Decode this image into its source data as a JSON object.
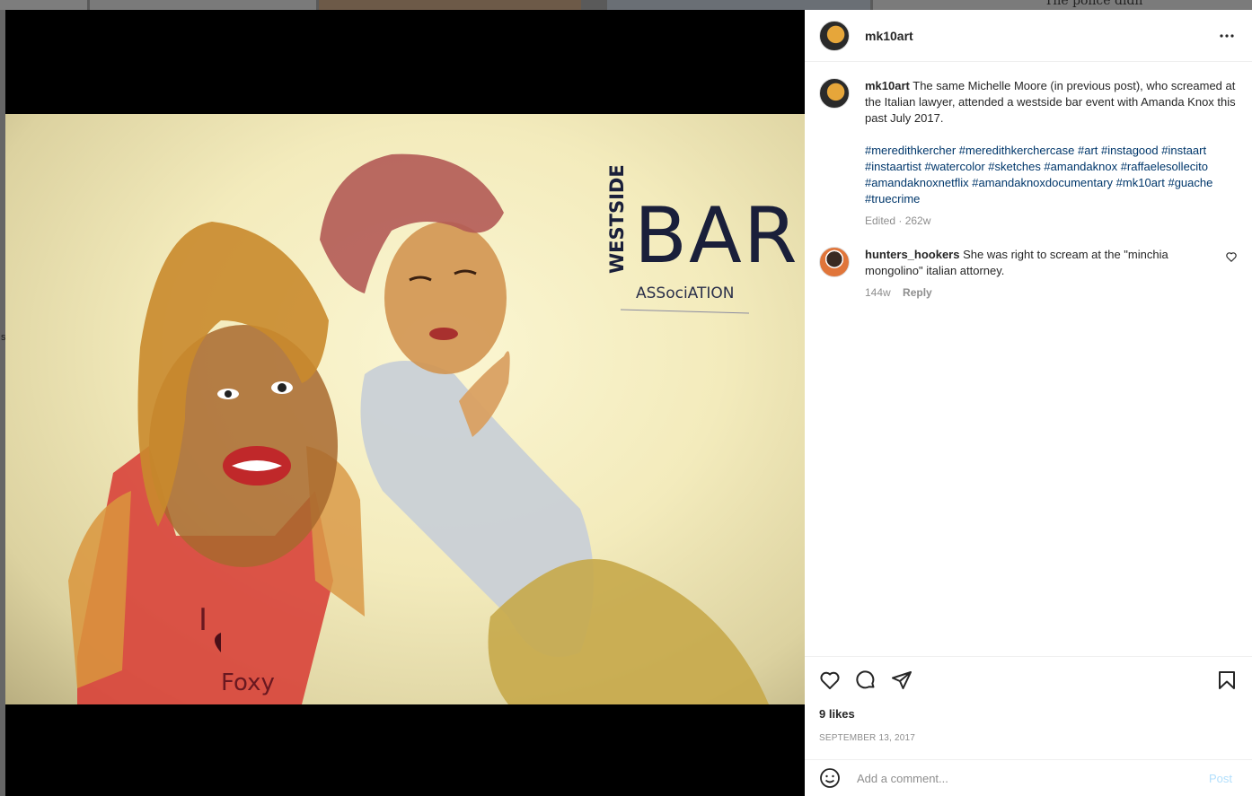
{
  "background": {
    "snippet_text": "The police didn",
    "side_letter": "s"
  },
  "post": {
    "username": "mk10art",
    "art_text": {
      "westside": "WESTSIDE",
      "bar": "BAR",
      "association": "ASSociATION",
      "i": "I",
      "foxy": "Foxy"
    },
    "caption": {
      "username": "mk10art",
      "text": "The same Michelle Moore (in previous post), who screamed at the Italian lawyer, attended a westside bar event with Amanda Knox this past July 2017.",
      "hashtags": "#meredithkercher #meredithkerchercase #art #instagood #instaart #instaartist #watercolor #sketches #amandaknox #raffaelesollecito #amandaknoxnetflix #amandaknoxdocumentary #mk10art #guache #truecrime",
      "meta": "Edited · 262w"
    },
    "comment": {
      "username": "hunters_hookers",
      "text": "She was right to scream at the \"minchia mongolino\" italian attorney.",
      "age": "144w",
      "reply_label": "Reply"
    },
    "likes": "9 likes",
    "date": "SEPTEMBER 13, 2017",
    "add_comment_placeholder": "Add a comment...",
    "post_label": "Post"
  },
  "icons": {
    "more": "more-horizontal-icon",
    "like": "heart-icon",
    "comment": "comment-bubble-icon",
    "share": "paper-plane-icon",
    "save": "bookmark-icon",
    "emoji": "smiley-icon"
  },
  "colors": {
    "link": "#00376b",
    "muted": "#8e8e8e",
    "text": "#262626",
    "post_disabled": "#b2dffc"
  }
}
